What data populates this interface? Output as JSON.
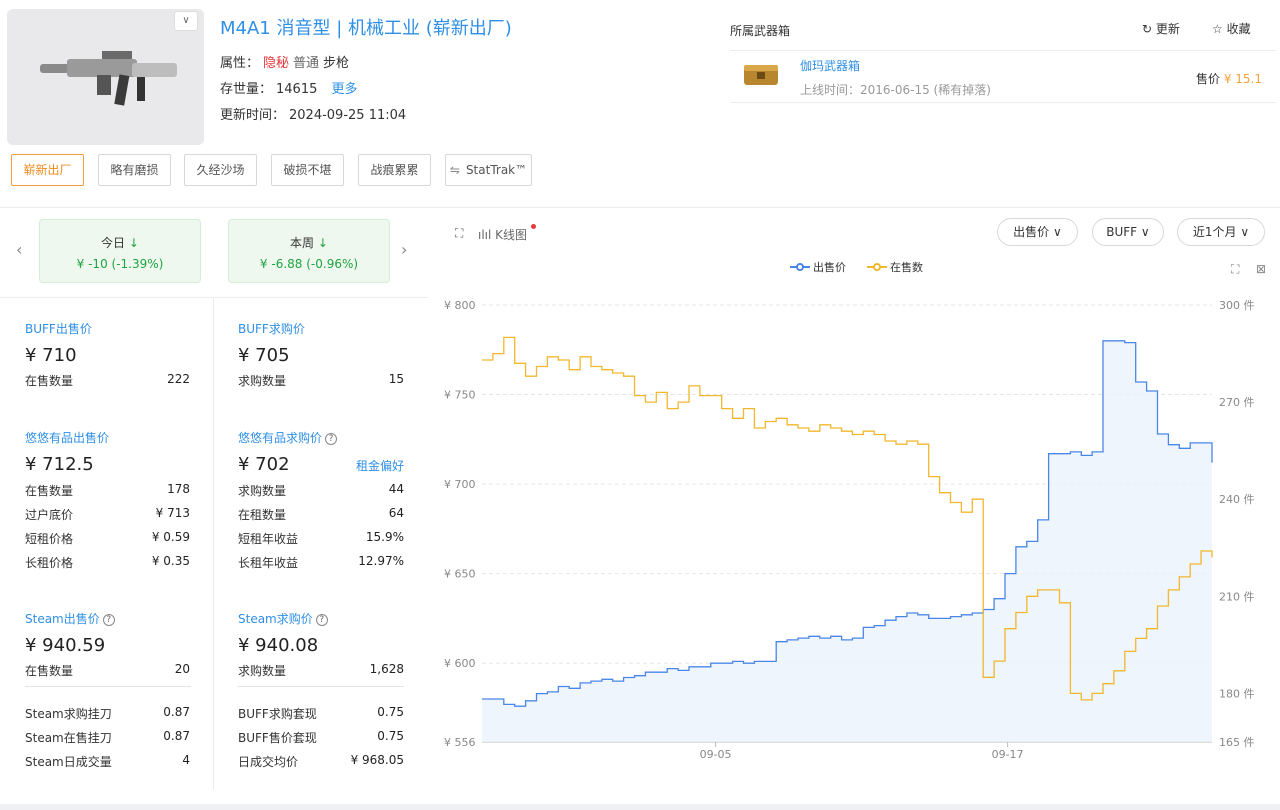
{
  "item": {
    "title": "M4A1 消音型 | 机械工业 (崭新出厂)",
    "attr_label": "属性：",
    "rarity": "隐秘",
    "quality": "普通",
    "type": "步枪",
    "stock_label": "存世量：",
    "stock": "14615",
    "more_link": "更多",
    "update_label": "更新时间：",
    "update_time": "2024-09-25 11:04",
    "thumb_toggle": "∨"
  },
  "wear_tabs": [
    "崭新出厂",
    "略有磨损",
    "久经沙场",
    "破损不堪",
    "战痕累累",
    "StatTrak™"
  ],
  "case_panel": {
    "title": "所属武器箱",
    "refresh": "更新",
    "favorite": "收藏",
    "case_name": "伽玛武器箱",
    "launch": "上线时间：2016-06-15 (稀有掉落)",
    "price_label": "售价",
    "price": "¥ 15.1"
  },
  "changes": {
    "today_label": "今日",
    "today_value": "¥ -10  (-1.39%)",
    "week_label": "本周",
    "week_value": "¥ -6.88  (-0.96%)"
  },
  "markets": {
    "buff_sell": {
      "title": "BUFF出售价",
      "price": "¥ 710",
      "rows": [
        [
          "在售数量",
          "222"
        ]
      ]
    },
    "buff_buy": {
      "title": "BUFF求购价",
      "price": "¥ 705",
      "rows": [
        [
          "求购数量",
          "15"
        ]
      ]
    },
    "yy_sell": {
      "title": "悠悠有品出售价",
      "price": "¥ 712.5",
      "rows": [
        [
          "在售数量",
          "178"
        ],
        [
          "过户底价",
          "¥ 713"
        ],
        [
          "短租价格",
          "¥ 0.59"
        ],
        [
          "长租价格",
          "¥ 0.35"
        ]
      ]
    },
    "yy_buy": {
      "title": "悠悠有品求购价",
      "price": "¥ 702",
      "tag": "租金偏好",
      "rows": [
        [
          "求购数量",
          "44"
        ],
        [
          "在租数量",
          "64"
        ],
        [
          "短租年收益",
          "15.9%"
        ],
        [
          "长租年收益",
          "12.97%"
        ]
      ]
    },
    "steam_sell": {
      "title": "Steam出售价",
      "price": "¥ 940.59",
      "rows": [
        [
          "在售数量",
          "20"
        ]
      ],
      "extra": [
        [
          "Steam求购挂刀",
          "0.87"
        ],
        [
          "Steam在售挂刀",
          "0.87"
        ],
        [
          "Steam日成交量",
          "4"
        ]
      ]
    },
    "steam_buy": {
      "title": "Steam求购价",
      "price": "¥ 940.08",
      "rows": [
        [
          "求购数量",
          "1,628"
        ]
      ],
      "extra": [
        [
          "BUFF求购套现",
          "0.75"
        ],
        [
          "BUFF售价套现",
          "0.75"
        ],
        [
          "日成交均价",
          "¥ 968.05"
        ]
      ]
    }
  },
  "chart_controls": {
    "kline": "K线图",
    "price_type": "出售价",
    "platform": "BUFF",
    "range": "近1个月"
  },
  "chart_data": {
    "type": "line",
    "series": [
      {
        "name": "出售价",
        "axis": "left",
        "color": "#4a86e8",
        "values": [
          580,
          580,
          577,
          576,
          579,
          583,
          584,
          587,
          586,
          589,
          590,
          591,
          590,
          592,
          593,
          595,
          595,
          597,
          596,
          598,
          598,
          600,
          600,
          601,
          600,
          601,
          601,
          612,
          613,
          614,
          615,
          614,
          615,
          613,
          614,
          620,
          621,
          624,
          626,
          628,
          627,
          625,
          625,
          626,
          627,
          628,
          630,
          636,
          650,
          665,
          668,
          680,
          717,
          717,
          718,
          716,
          718,
          780,
          780,
          779,
          757,
          752,
          728,
          722,
          720,
          723,
          723,
          712
        ]
      },
      {
        "name": "在售数",
        "axis": "right",
        "color": "#f2b72c",
        "values": [
          283,
          285,
          290,
          282,
          278,
          281,
          284,
          283,
          280,
          284,
          281,
          280,
          279,
          278,
          272,
          270,
          273,
          268,
          270,
          275,
          272,
          272,
          268,
          265,
          268,
          262,
          264,
          265,
          263,
          262,
          261,
          263,
          262,
          261,
          260,
          261,
          260,
          258,
          257,
          258,
          257,
          247,
          242,
          239,
          236,
          240,
          185,
          190,
          200,
          205,
          210,
          212,
          212,
          208,
          180,
          178,
          180,
          183,
          187,
          193,
          197,
          200,
          207,
          212,
          216,
          220,
          224,
          222
        ]
      }
    ],
    "x_ticks": [
      "09-05",
      "09-17"
    ],
    "y_left": {
      "ticks": [
        "¥ 800",
        "¥ 750",
        "¥ 700",
        "¥ 650",
        "¥ 600",
        "¥ 556"
      ],
      "range": [
        556,
        800
      ]
    },
    "y_right": {
      "ticks": [
        "300 件",
        "270 件",
        "240 件",
        "210 件",
        "180 件",
        "165 件"
      ],
      "range": [
        165,
        300
      ]
    },
    "legend": "top-center",
    "grid": true
  }
}
